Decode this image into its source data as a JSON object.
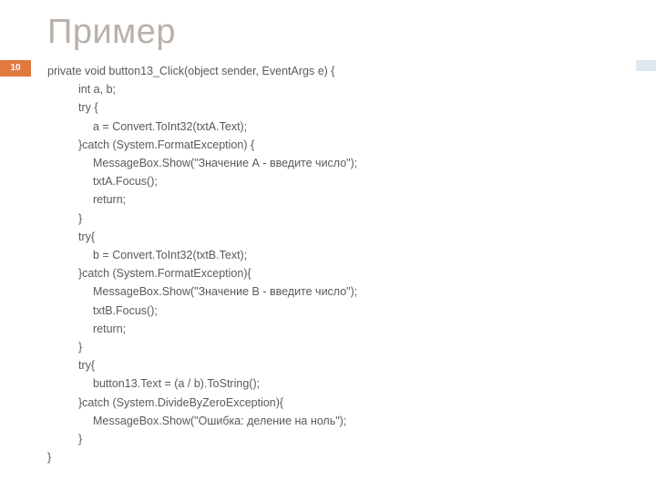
{
  "slide": {
    "title": "Пример",
    "page_number": "10",
    "code_lines": [
      {
        "indent": 0,
        "text": "private void button13_Click(object sender, EventArgs e) {"
      },
      {
        "indent": 1,
        "text": "int a, b;"
      },
      {
        "indent": 1,
        "text": "try {"
      },
      {
        "indent": 2,
        "text": "a = Convert.ToInt32(txtA.Text);"
      },
      {
        "indent": 1,
        "text": "}catch (System.FormatException) {"
      },
      {
        "indent": 2,
        "text": "MessageBox.Show(\"Значение А - введите число\");"
      },
      {
        "indent": 2,
        "text": "txtA.Focus();"
      },
      {
        "indent": 2,
        "text": "return;"
      },
      {
        "indent": 1,
        "text": "}"
      },
      {
        "indent": 1,
        "text": "try{"
      },
      {
        "indent": 2,
        "text": "b = Convert.ToInt32(txtB.Text);"
      },
      {
        "indent": 1,
        "text": "}catch (System.FormatException){"
      },
      {
        "indent": 2,
        "text": "MessageBox.Show(\"Значение B - введите число\");"
      },
      {
        "indent": 2,
        "text": "txtB.Focus();"
      },
      {
        "indent": 2,
        "text": "return;"
      },
      {
        "indent": 1,
        "text": "}"
      },
      {
        "indent": 1,
        "text": "try{"
      },
      {
        "indent": 2,
        "text": "button13.Text = (a / b).ToString();"
      },
      {
        "indent": 1,
        "text": "}catch (System.DivideByZeroException){"
      },
      {
        "indent": 2,
        "text": "MessageBox.Show(\"Ошибка: деление на ноль\");"
      },
      {
        "indent": 1,
        "text": "}"
      },
      {
        "indent": 0,
        "text": "}"
      }
    ]
  }
}
